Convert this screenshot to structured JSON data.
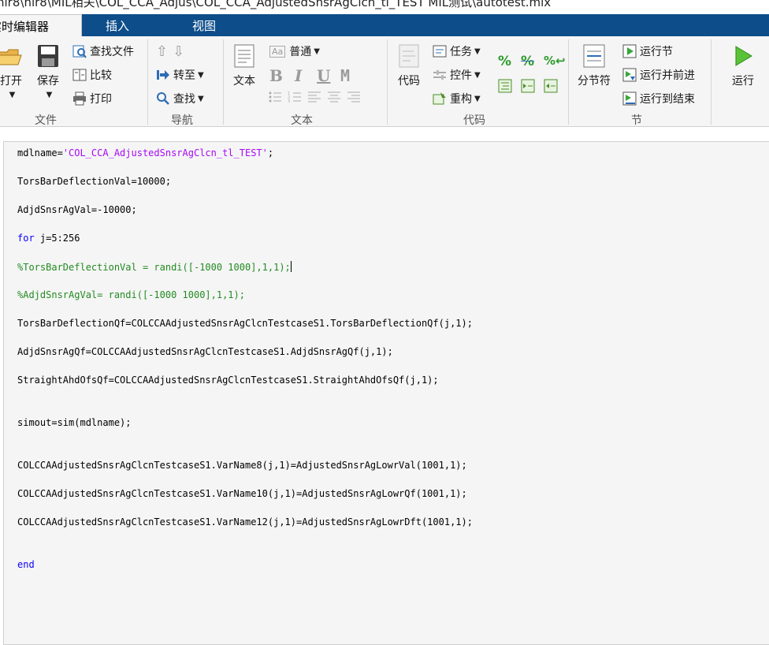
{
  "window": {
    "path": "hir8\\hir8\\MIL相关\\COL_CCA_Adjus\\COL_CCA_AdjustedSnsrAgClcn_tl_TEST MIL测试\\autotest.mlx"
  },
  "tabs": [
    {
      "label": "实时编辑器",
      "active": true
    },
    {
      "label": "插入",
      "active": false
    },
    {
      "label": "视图",
      "active": false
    }
  ],
  "ribbon": {
    "file": {
      "group": "文件",
      "open": "打开",
      "save": "保存",
      "find_files": "查找文件",
      "compare": "比较",
      "print": "打印"
    },
    "nav": {
      "group": "导航",
      "goto": "转至",
      "find": "查找"
    },
    "text": {
      "group": "文本",
      "text_btn": "文本",
      "style": "普通",
      "bold": "B",
      "italic": "I",
      "underline": "U",
      "mono": "M"
    },
    "code": {
      "group": "代码",
      "code_btn": "代码",
      "task": "任务",
      "control": "控件",
      "refactor": "重构"
    },
    "section": {
      "group": "节",
      "break": "分节符",
      "run_section": "运行节",
      "run_advance": "运行并前进",
      "run_to_end": "运行到结束"
    },
    "run": {
      "run_btn": "运行"
    }
  },
  "editor": {
    "lines": [
      {
        "parts": [
          "mdlname=",
          "'COL_CCA_AdjustedSnsrAgClcn_tl_TEST'",
          ";"
        ]
      },
      {
        "text": "TorsBarDeflectionVal=10000;"
      },
      {
        "text": "AdjdSnsrAgVal=-10000;"
      },
      {
        "parts": [
          "for",
          " j=5:256"
        ]
      },
      {
        "text": "%TorsBarDeflectionVal = randi([-1000 1000],1,1);"
      },
      {
        "text": "%AdjdSnsrAgVal= randi([-1000 1000],1,1);"
      },
      {
        "text": "TorsBarDeflectionQf=COLCCAAdjustedSnsrAgClcnTestcaseS1.TorsBarDeflectionQf(j,1);"
      },
      {
        "text": "AdjdSnsrAgQf=COLCCAAdjustedSnsrAgClcnTestcaseS1.AdjdSnsrAgQf(j,1);"
      },
      {
        "text": "StraightAhdOfsQf=COLCCAAdjustedSnsrAgClcnTestcaseS1.StraightAhdOfsQf(j,1);"
      },
      {
        "text": "simout=sim(mdlname);"
      },
      {
        "text": "COLCCAAdjustedSnsrAgClcnTestcaseS1.VarName8(j,1)=AdjustedSnsrAgLowrVal(1001,1);"
      },
      {
        "text": "COLCCAAdjustedSnsrAgClcnTestcaseS1.VarName10(j,1)=AdjustedSnsrAgLowrQf(1001,1);"
      },
      {
        "text": "COLCCAAdjustedSnsrAgClcnTestcaseS1.VarName12(j,1)=AdjustedSnsrAgLowrDft(1001,1);"
      },
      {
        "text": "end"
      }
    ]
  },
  "colors": {
    "tabbar": "#0d4d8a",
    "ribbon": "#f5f5f5",
    "keyword": "#0e00ff",
    "string": "#a709f5",
    "comment": "#228b22"
  }
}
